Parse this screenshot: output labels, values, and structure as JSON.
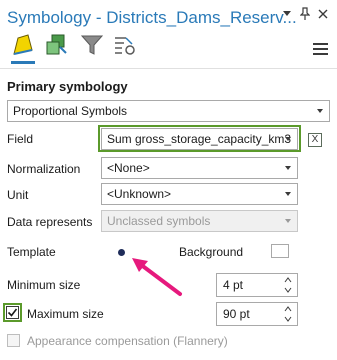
{
  "window": {
    "title": "Symbology - Districts_Dams_Reserv...",
    "buttons": [
      "options",
      "pin",
      "close"
    ]
  },
  "toolbar": {
    "tabs": [
      "primary-symbology-icon",
      "secondary-symbology-icon",
      "filter-icon",
      "list-settings-icon"
    ],
    "menu_icon": "hamburger-icon"
  },
  "section": {
    "title": "Primary symbology"
  },
  "symbology_type": "Proportional Symbols",
  "field": {
    "label": "Field",
    "value": "Sum gross_storage_capacity_km3",
    "expression_glyph": "X"
  },
  "normalization": {
    "label": "Normalization",
    "value": "<None>"
  },
  "unit": {
    "label": "Unit",
    "value": "<Unknown>"
  },
  "data_represents": {
    "label": "Data represents",
    "value": "Unclassed symbols"
  },
  "template": {
    "label": "Template"
  },
  "background": {
    "label": "Background"
  },
  "minimum_size": {
    "label": "Minimum size",
    "value": "4 pt"
  },
  "maximum_size": {
    "label": "Maximum size",
    "value": "90 pt",
    "checked": true
  },
  "appearance_compensation": {
    "label": "Appearance compensation (Flannery)",
    "checked": false
  },
  "colors": {
    "accent": "#2a7ab8",
    "highlight_box": "#5b9a2b",
    "arrow": "#e6197d",
    "template_dot": "#1f2d5a"
  }
}
